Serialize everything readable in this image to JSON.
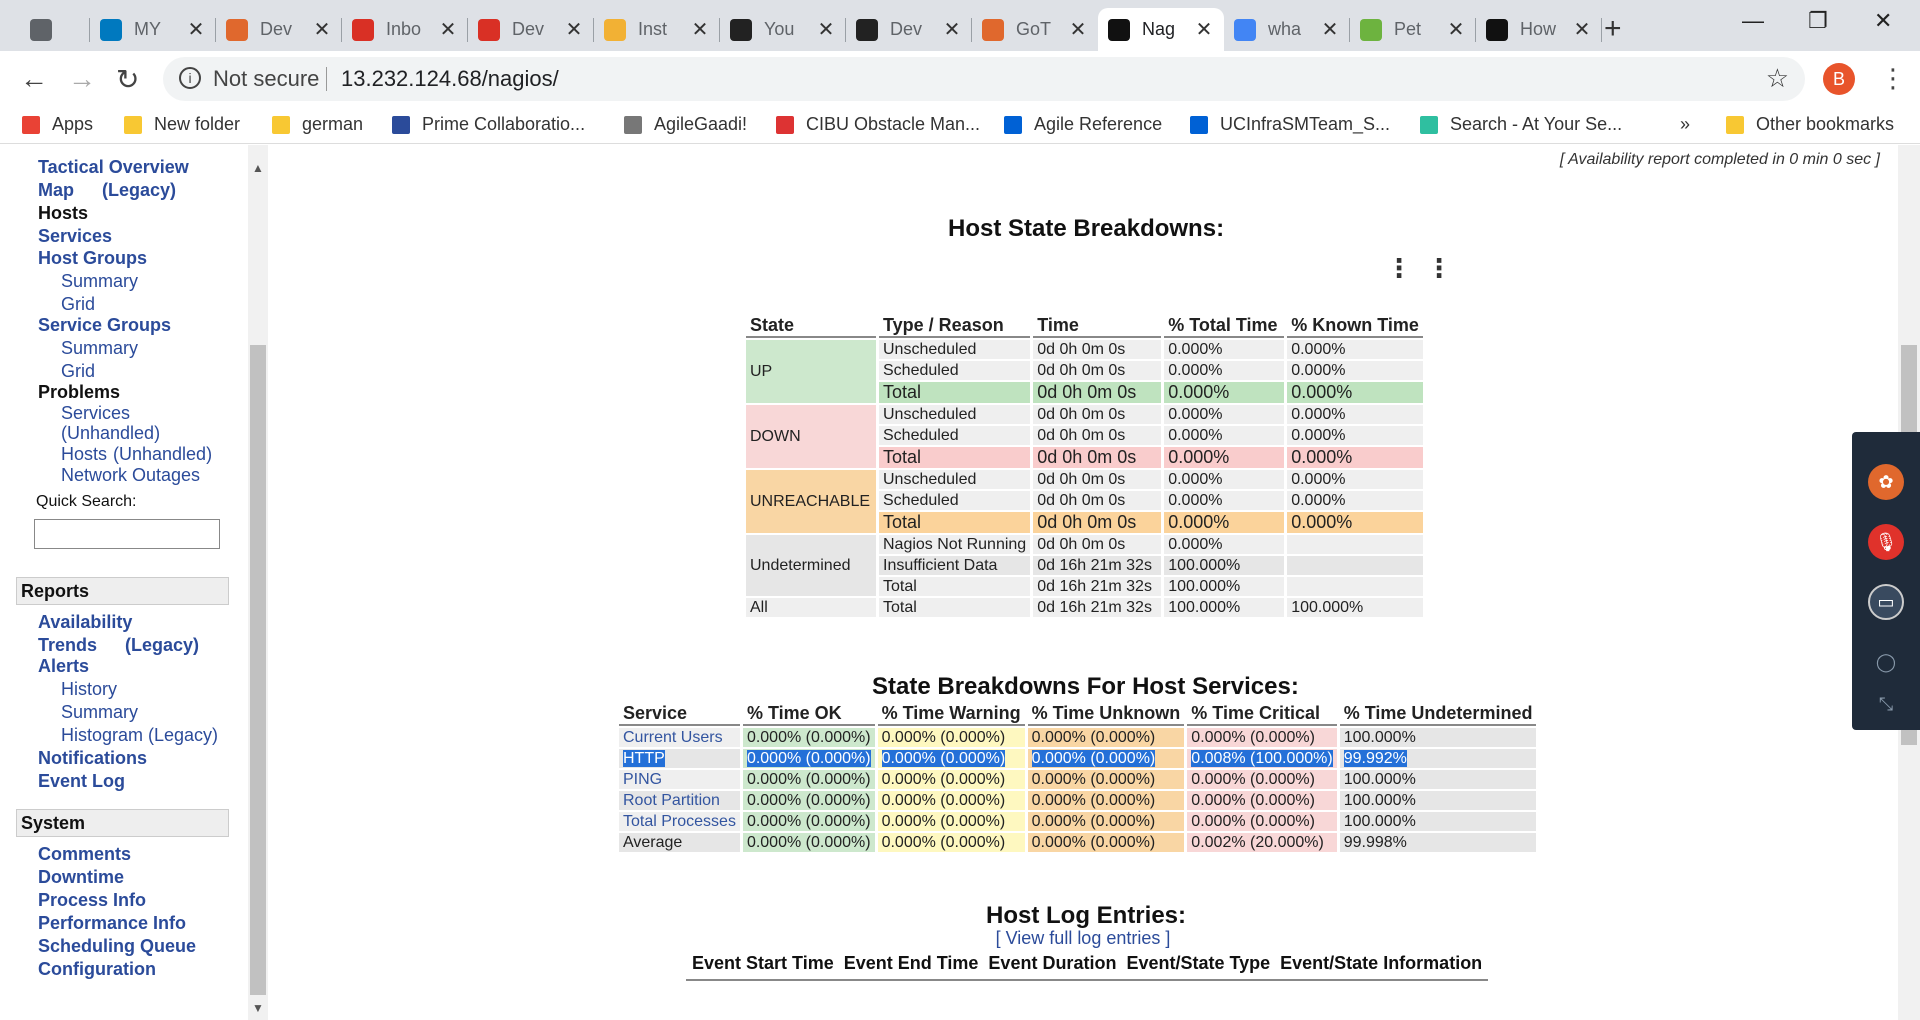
{
  "browser": {
    "tabs": [
      {
        "title": "",
        "icon": "app-icon"
      },
      {
        "title": "MY",
        "icon": "trello-icon",
        "color": "#0079bf"
      },
      {
        "title": "Dev",
        "icon": "devops-icon",
        "color": "#e0682d"
      },
      {
        "title": "Inbo",
        "icon": "gmail-icon",
        "color": "#d93025"
      },
      {
        "title": "Dev",
        "icon": "gmail-icon",
        "color": "#d93025"
      },
      {
        "title": "Inst",
        "icon": "aws-icon",
        "color": "#f2b134"
      },
      {
        "title": "You",
        "icon": "github-icon",
        "color": "#222"
      },
      {
        "title": "Dev",
        "icon": "github-icon",
        "color": "#222"
      },
      {
        "title": "GoT",
        "icon": "gocd-icon",
        "color": "#e0682d"
      },
      {
        "title": "Nag",
        "icon": "nagios-icon",
        "color": "#111"
      },
      {
        "title": "wha",
        "icon": "google-icon",
        "color": "#4285f4"
      },
      {
        "title": "Pet",
        "icon": "spring-icon",
        "color": "#6db33f"
      },
      {
        "title": "How",
        "icon": "hexagon-icon",
        "color": "#111"
      }
    ],
    "address": {
      "security": "Not secure",
      "url": "13.232.124.68/nagios/"
    },
    "profile_initial": "B",
    "bookmarks": [
      {
        "label": "Apps",
        "icon": "apps-grid-icon"
      },
      {
        "label": "New folder",
        "icon": "folder-icon"
      },
      {
        "label": "german",
        "icon": "folder-icon"
      },
      {
        "label": "Prime Collaboratio...",
        "icon": "prime-icon"
      },
      {
        "label": "AgileGaadi!",
        "icon": "agile-icon"
      },
      {
        "label": "CIBU Obstacle Man...",
        "icon": "cisco-icon"
      },
      {
        "label": "Agile Reference",
        "icon": "box-icon"
      },
      {
        "label": "UCInfraSMTeam_S...",
        "icon": "box-icon"
      },
      {
        "label": "Search - At Your Se...",
        "icon": "search-bm-icon"
      },
      {
        "label": "»",
        "icon": "overflow"
      },
      {
        "label": "Other bookmarks",
        "icon": "folder-icon"
      }
    ]
  },
  "nav": {
    "tactical": "Tactical Overview",
    "map": "Map",
    "map_legacy": "(Legacy)",
    "hosts": "Hosts",
    "services": "Services",
    "host_groups": "Host Groups",
    "hg_summary": "Summary",
    "hg_grid": "Grid",
    "service_groups": "Service Groups",
    "sg_summary": "Summary",
    "sg_grid": "Grid",
    "problems": "Problems",
    "p_services": "Services",
    "p_unhandled": "(Unhandled)",
    "p_hosts": "Hosts",
    "p_hosts_unhandled": "(Unhandled)",
    "p_outages": "Network Outages",
    "quick_search_label": "Quick Search:",
    "reports": "Reports",
    "availability": "Availability",
    "trends": "Trends",
    "trends_legacy": "(Legacy)",
    "alerts": "Alerts",
    "a_history": "History",
    "a_summary": "Summary",
    "a_histogram": "Histogram (Legacy)",
    "notifications": "Notifications",
    "event_log": "Event Log",
    "system": "System",
    "comments": "Comments",
    "downtime": "Downtime",
    "process_info": "Process Info",
    "performance_info": "Performance Info",
    "scheduling_queue": "Scheduling Queue",
    "configuration": "Configuration"
  },
  "report": {
    "completed_note": "[ Availability report completed in 0 min 0 sec ]",
    "host_state_title": "Host State Breakdowns:",
    "host_headers": [
      "State",
      "Type / Reason",
      "Time",
      "% Total Time",
      "% Known Time"
    ],
    "host_rows": [
      {
        "state": "UP",
        "rows": [
          [
            "Unscheduled",
            "0d 0h 0m 0s",
            "0.000%",
            "0.000%"
          ],
          [
            "Scheduled",
            "0d 0h 0m 0s",
            "0.000%",
            "0.000%"
          ],
          [
            "Total",
            "0d 0h 0m 0s",
            "0.000%",
            "0.000%"
          ]
        ]
      },
      {
        "state": "DOWN",
        "rows": [
          [
            "Unscheduled",
            "0d 0h 0m 0s",
            "0.000%",
            "0.000%"
          ],
          [
            "Scheduled",
            "0d 0h 0m 0s",
            "0.000%",
            "0.000%"
          ],
          [
            "Total",
            "0d 0h 0m 0s",
            "0.000%",
            "0.000%"
          ]
        ]
      },
      {
        "state": "UNREACHABLE",
        "rows": [
          [
            "Unscheduled",
            "0d 0h 0m 0s",
            "0.000%",
            "0.000%"
          ],
          [
            "Scheduled",
            "0d 0h 0m 0s",
            "0.000%",
            "0.000%"
          ],
          [
            "Total",
            "0d 0h 0m 0s",
            "0.000%",
            "0.000%"
          ]
        ]
      },
      {
        "state": "Undetermined",
        "rows": [
          [
            "Nagios Not Running",
            "0d 0h 0m 0s",
            "0.000%",
            ""
          ],
          [
            "Insufficient Data",
            "0d 16h 21m 32s",
            "100.000%",
            ""
          ],
          [
            "Total",
            "0d 16h 21m 32s",
            "100.000%",
            ""
          ]
        ]
      },
      {
        "state": "All",
        "rows": [
          [
            "Total",
            "0d 16h 21m 32s",
            "100.000%",
            "100.000%"
          ]
        ]
      }
    ],
    "svc_title": "State Breakdowns For Host Services:",
    "svc_headers": [
      "Service",
      "% Time OK",
      "% Time Warning",
      "% Time Unknown",
      "% Time Critical",
      "% Time Undetermined"
    ],
    "svc_rows": [
      [
        "Current Users",
        "0.000% (0.000%)",
        "0.000% (0.000%)",
        "0.000% (0.000%)",
        "0.000% (0.000%)",
        "100.000%"
      ],
      [
        "HTTP",
        "0.000% (0.000%)",
        "0.000% (0.000%)",
        "0.000% (0.000%)",
        "0.008% (100.000%)",
        "99.992%"
      ],
      [
        "PING",
        "0.000% (0.000%)",
        "0.000% (0.000%)",
        "0.000% (0.000%)",
        "0.000% (0.000%)",
        "100.000%"
      ],
      [
        "Root Partition",
        "0.000% (0.000%)",
        "0.000% (0.000%)",
        "0.000% (0.000%)",
        "0.000% (0.000%)",
        "100.000%"
      ],
      [
        "Total Processes",
        "0.000% (0.000%)",
        "0.000% (0.000%)",
        "0.000% (0.000%)",
        "0.000% (0.000%)",
        "100.000%"
      ],
      [
        "Average",
        "0.000% (0.000%)",
        "0.000% (0.000%)",
        "0.000% (0.000%)",
        "0.002% (20.000%)",
        "99.998%"
      ]
    ],
    "log_title": "Host Log Entries:",
    "log_link": "[ View full log entries ]",
    "log_headers": [
      "Event Start Time",
      "Event End Time",
      "Event Duration",
      "Event/State Type",
      "Event/State Information"
    ]
  },
  "colors": {
    "link": "#2b4b9a",
    "up": "#cde8cd",
    "down": "#f8d7d7",
    "unreachable": "#f9d6a4",
    "warning": "#fef8c0",
    "selection": "#2470d8"
  }
}
